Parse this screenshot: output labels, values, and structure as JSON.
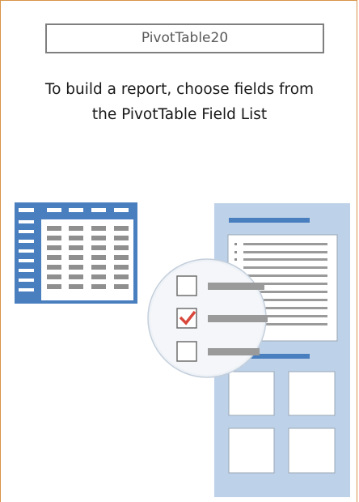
{
  "pivot": {
    "name": "PivotTable20",
    "instructions_line1": "To build a report, choose fields from",
    "instructions_line2": "the PivotTable Field List"
  },
  "illustration": {
    "items": [
      "table-grid-icon",
      "field-list-panel-icon",
      "field-checkbox-list-icon"
    ],
    "colors": {
      "panel": "#bdd1e8",
      "blue": "#4a7fbf",
      "gray": "#9a9a9a",
      "check": "#d9473a",
      "border": "#d99348"
    }
  }
}
